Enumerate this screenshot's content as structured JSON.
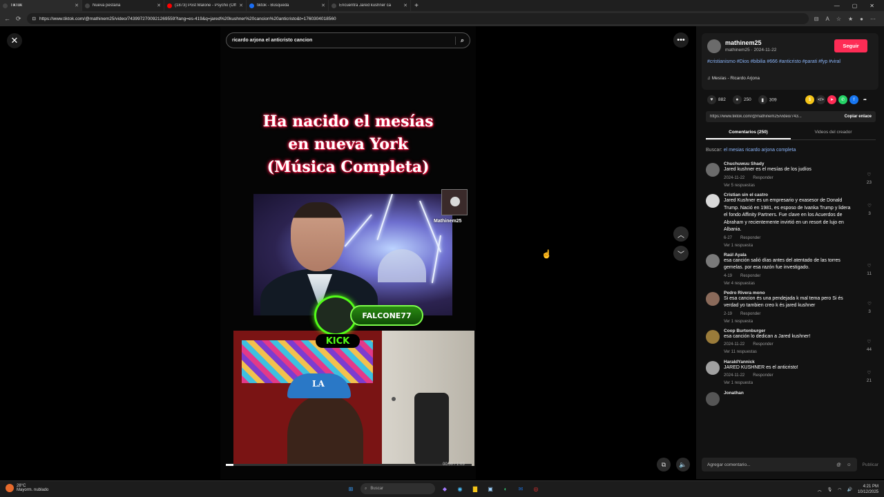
{
  "browser": {
    "tabs": [
      {
        "title": "TikTok",
        "color": "#111111"
      },
      {
        "title": "Nueva pestaña",
        "color": "#444444"
      },
      {
        "title": "(1873) Post Malone - Psycho (Off",
        "color": "#ff0000"
      },
      {
        "title": "tiktok - Búsqueda",
        "color": "#1b6ef3"
      },
      {
        "title": "Encuentra Jared kushner ca",
        "color": "#111111"
      }
    ],
    "url": "https://www.tiktok.com/@mathinem25/video/7439972700921269559?lang=es-419&q=jared%20kushner%20cancion%20anticristo&t=1760304018560"
  },
  "video": {
    "search_query": "ricardo arjona el anticristo cancion",
    "headline": [
      "Ha nacido el mesías",
      "en nueva York",
      "(Música Completa)"
    ],
    "watermark": "Mathinem25",
    "streamer": "FALCONE77",
    "platform": "KICK",
    "progress": 0.03,
    "timecode": "00:00 / 1:03"
  },
  "author": {
    "name": "mathinem25",
    "meta": "mathinem25 · 2024-11-22",
    "follow_label": "Seguir",
    "hashtags": "#cristianismo #Dios #bibilia #666 #anticristo #parati #fyp #viral",
    "music": "Mesías - Ricardo Arjona"
  },
  "stats": {
    "likes": "882",
    "comments": "250",
    "saves": "309"
  },
  "link": {
    "url": "https://www.tiktok.com/@mathinem25/video/743...",
    "copy_label": "Copiar enlace"
  },
  "panel_tabs": {
    "comments": "Comentarios (250)",
    "creator": "Videos del creador"
  },
  "search_line": {
    "prefix": "Buscar:",
    "query": "el mesias ricardo arjona completa"
  },
  "comments": [
    {
      "name": "Chuchuwuu Shady",
      "text": "Jared kushner es el mesías de los judíos",
      "date": "2024-11-22",
      "reply": "Responder",
      "replies": "Ver 5 respuestas",
      "likes": "23",
      "avatar": "#6b6b6b"
    },
    {
      "name": "Cristian sin el castro",
      "text": "Jared Kushner es un empresario y exasesor de Donald Trump. Nació en 1981, es esposo de Ivanka Trump y lidera el fondo Affinity Partners. Fue clave en los Acuerdos de Abraham y recientemente invirtió en un resort de lujo en Albania.",
      "date": "6-27",
      "reply": "Responder",
      "replies": "Ver 1 respuesta",
      "likes": "3",
      "avatar": "#d9d9d9"
    },
    {
      "name": "Raúl Ayala",
      "text": "esa canción salió días antes del atentado de las torres gemelas. por esa razón fue investigado.",
      "date": "4-19",
      "reply": "Responder",
      "replies": "Ver 4 respuestas",
      "likes": "11",
      "avatar": "#7a7a7a"
    },
    {
      "name": "Pedro Rivera mono",
      "text": "Si esa cancion és una pendejada k mal tema pero Si és verdad yo tambien creo k és jared kushner",
      "date": "2-19",
      "reply": "Responder",
      "replies": "Ver 1 respuesta",
      "likes": "3",
      "avatar": "#8a6a5a"
    },
    {
      "name": "Coop Burtonburger",
      "text": "esa canción lo dedican a Jared kushner!",
      "date": "2024-11-22",
      "reply": "Responder",
      "replies": "Ver 11 respuestas",
      "likes": "44",
      "avatar": "#9a7b3a"
    },
    {
      "name": "HaraldYannick",
      "text": "JARED KUSHNER es el anticristo!",
      "date": "2024-11-22",
      "reply": "Responder",
      "replies": "Ver 1 respuesta",
      "likes": "21",
      "avatar": "#a0a0a0"
    },
    {
      "name": "Jonathan",
      "text": "",
      "date": "",
      "reply": "",
      "replies": "",
      "likes": "",
      "avatar": "#555555"
    }
  ],
  "compose": {
    "placeholder": "Agregar comentario...",
    "publish": "Publicar"
  },
  "taskbar": {
    "weather_temp": "28°C",
    "weather_desc": "Mayorm. nublado",
    "search": "Buscar",
    "time": "4:21 PM",
    "date": "10/12/2025"
  }
}
